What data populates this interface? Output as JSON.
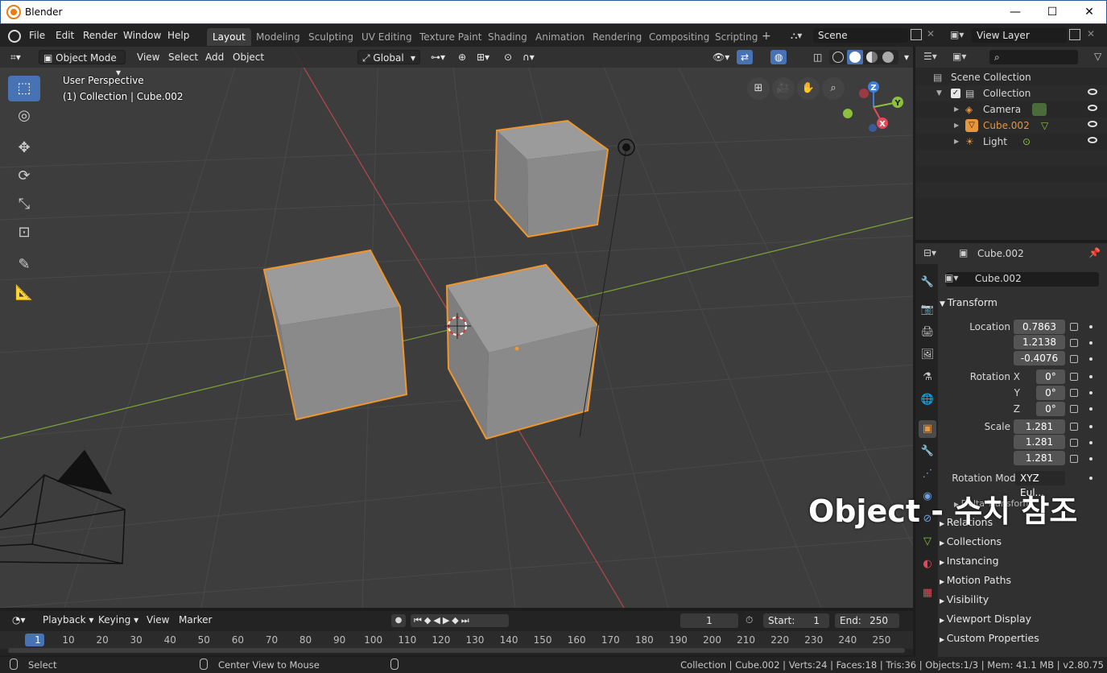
{
  "window": {
    "title": "Blender",
    "minimize": "—",
    "maximize": "☐",
    "close": "✕"
  },
  "menus": [
    "File",
    "Edit",
    "Render",
    "Window",
    "Help"
  ],
  "workspaces": [
    "Layout",
    "Modeling",
    "Sculpting",
    "UV Editing",
    "Texture Paint",
    "Shading",
    "Animation",
    "Rendering",
    "Compositing",
    "Scripting"
  ],
  "active_workspace": "Layout",
  "scene": {
    "name": "Scene",
    "view_layer": "View Layer"
  },
  "viewport": {
    "mode": "Object Mode",
    "menus": [
      "View",
      "Select",
      "Add",
      "Object"
    ],
    "orientation": "Global",
    "overlay_line1": "User Perspective",
    "overlay_line2": "(1) Collection | Cube.002",
    "gizmo_axes": {
      "x": "X",
      "y": "Y",
      "z": "Z"
    }
  },
  "outliner": {
    "root": "Scene Collection",
    "collection": "Collection",
    "items": [
      "Camera",
      "Cube.002",
      "Light"
    ],
    "selected_color": "#e8963a"
  },
  "properties": {
    "object_name": "Cube.002",
    "name_field": "Cube.002",
    "transform_label": "Transform",
    "location_label": "Location X",
    "rotation_label": "Rotation X",
    "scale_label": "Scale X",
    "y_label": "Y",
    "z_label": "Z",
    "location": [
      "0.7863",
      "1.2138",
      "-0.4076"
    ],
    "rotation": [
      "0°",
      "0°",
      "0°"
    ],
    "scale": [
      "1.281",
      "1.281",
      "1.281"
    ],
    "rotation_mode_label": "Rotation Mode",
    "rotation_mode": "XYZ Eul...",
    "delta_transform": "Delta Transform",
    "panels": [
      "Relations",
      "Collections",
      "Instancing",
      "Motion Paths",
      "Visibility",
      "Viewport Display",
      "Custom Properties"
    ]
  },
  "caption": "Object - 수치 참조",
  "timeline": {
    "menus": [
      "Playback",
      "Keying",
      "View",
      "Marker"
    ],
    "current_frame": "1",
    "start_label": "Start:",
    "start": "1",
    "end_label": "End:",
    "end": "250",
    "ruler": [
      "1",
      "10",
      "20",
      "30",
      "40",
      "50",
      "60",
      "70",
      "80",
      "90",
      "100",
      "110",
      "120",
      "130",
      "140",
      "150",
      "160",
      "170",
      "180",
      "190",
      "200",
      "210",
      "220",
      "230",
      "240",
      "250"
    ]
  },
  "statusbar": {
    "left": "Select",
    "middle": "Center View to Mouse",
    "right": "Collection | Cube.002 | Verts:24 | Faces:18 | Tris:36 | Objects:1/3 | Mem: 41.1 MB | v2.80.75"
  },
  "colors": {
    "accent": "#4772b3",
    "selection": "#f0962a",
    "x_axis": "#e8495a",
    "y_axis": "#8ec040",
    "z_axis": "#3f7fd8"
  }
}
